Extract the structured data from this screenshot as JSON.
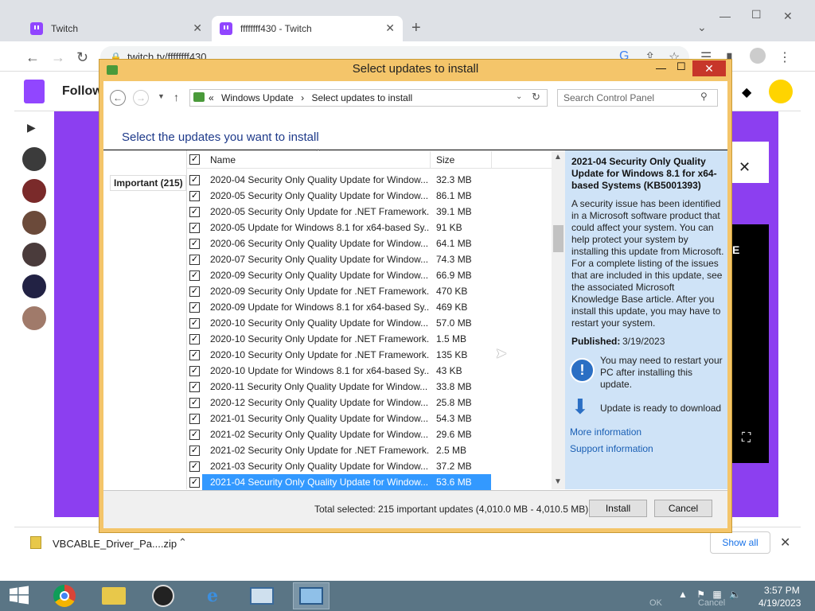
{
  "browser": {
    "tabs": [
      {
        "title": "Twitch"
      },
      {
        "title": "ffffffff430 - Twitch"
      }
    ],
    "url": "twitch.tv/ffffffff430",
    "new_tab_symbol": "+",
    "download": {
      "file": "VBCABLE_Driver_Pa....zip",
      "show_all": "Show all"
    }
  },
  "twitch": {
    "nav_label": "Followi",
    "video_letter": "E"
  },
  "dialog": {
    "title": "Select updates to install",
    "address": {
      "prefix": "«",
      "crumb1": "Windows Update",
      "crumb2": "Select updates to install"
    },
    "search_placeholder": "Search Control Panel",
    "heading": "Select the updates you want to install",
    "category": "Important (215)",
    "columns": {
      "name": "Name",
      "size": "Size"
    },
    "updates": [
      {
        "name": "2020-04 Security Only Quality Update for Window...",
        "size": "32.3 MB"
      },
      {
        "name": "2020-05 Security Only Quality Update for Window...",
        "size": "86.1 MB"
      },
      {
        "name": "2020-05 Security Only Update for .NET Framework...",
        "size": "39.1 MB"
      },
      {
        "name": "2020-05 Update for Windows 8.1 for x64-based Sy...",
        "size": "91 KB"
      },
      {
        "name": "2020-06 Security Only Quality Update for Window...",
        "size": "64.1 MB"
      },
      {
        "name": "2020-07 Security Only Quality Update for Window...",
        "size": "74.3 MB"
      },
      {
        "name": "2020-09 Security Only Quality Update for Window...",
        "size": "66.9 MB"
      },
      {
        "name": "2020-09 Security Only Update for .NET Framework...",
        "size": "470 KB"
      },
      {
        "name": "2020-09 Update for Windows 8.1 for x64-based Sy...",
        "size": "469 KB"
      },
      {
        "name": "2020-10 Security Only Quality Update for Window...",
        "size": "57.0 MB"
      },
      {
        "name": "2020-10 Security Only Update for .NET Framework...",
        "size": "1.5 MB"
      },
      {
        "name": "2020-10 Security Only Update for .NET Framework...",
        "size": "135 KB"
      },
      {
        "name": "2020-10 Update for Windows 8.1 for x64-based Sy...",
        "size": "43 KB"
      },
      {
        "name": "2020-11 Security Only Quality Update for Window...",
        "size": "33.8 MB"
      },
      {
        "name": "2020-12 Security Only Quality Update for Window...",
        "size": "25.8 MB"
      },
      {
        "name": "2021-01 Security Only Quality Update for Window...",
        "size": "54.3 MB"
      },
      {
        "name": "2021-02 Security Only Quality Update for Window...",
        "size": "29.6 MB"
      },
      {
        "name": "2021-02 Security Only Update for .NET Framework...",
        "size": "2.5 MB"
      },
      {
        "name": "2021-03 Security Only Quality Update for Window...",
        "size": "37.2 MB"
      },
      {
        "name": "2021-04 Security Only Quality Update for Window...",
        "size": "53.6 MB",
        "selected": true
      }
    ],
    "details": {
      "title": "2021-04 Security Only Quality Update for Windows 8.1 for x64-based Systems (KB5001393)",
      "description": "A security issue has been identified in a Microsoft software product that could affect your system. You can help protect your system by installing this update from Microsoft. For a complete listing of the issues that are included in this update, see the associated Microsoft Knowledge Base article. After you install this update, you may have to restart your system.",
      "published_label": "Published:",
      "published_value": "3/19/2023",
      "restart_note": "You may need to restart your PC after installing this update.",
      "ready_note": "Update is ready to download",
      "more_info": "More information",
      "support_info": "Support information"
    },
    "total": "Total selected: 215 important updates (4,010.0 MB - 4,010.5 MB)",
    "install_label": "Install",
    "cancel_label": "Cancel"
  },
  "taskbar": {
    "ghost_ok": "OK",
    "ghost_cancel": "Cancel",
    "time": "3:57 PM",
    "date": "4/19/2023"
  },
  "colors": {
    "dialog_frame": "#f4c56a",
    "selection": "#3399ff",
    "detail_pane": "#cfe3f7",
    "twitch_purple": "#9146ff",
    "taskbar": "#5a7585"
  }
}
